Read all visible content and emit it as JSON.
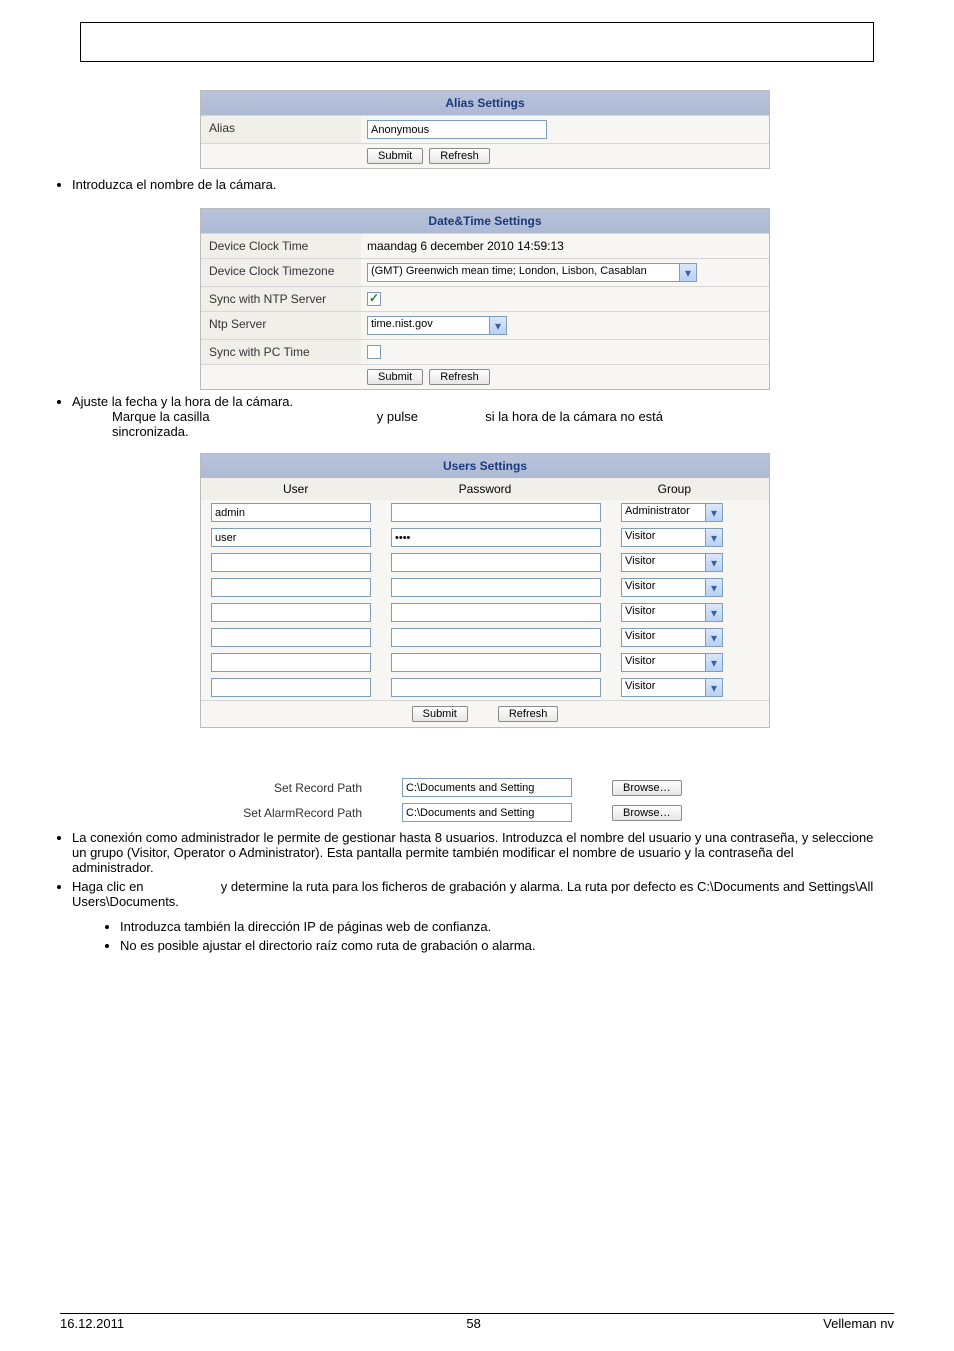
{
  "alias": {
    "title": "Alias Settings",
    "label": "Alias",
    "value": "Anonymous",
    "submit": "Submit",
    "refresh": "Refresh"
  },
  "text1": "Introduzca el nombre de la cámara.",
  "datetime": {
    "title": "Date&Time Settings",
    "r1lbl": "Device Clock Time",
    "r1val": "maandag 6 december 2010 14:59:13",
    "r2lbl": "Device Clock Timezone",
    "r2val": "(GMT) Greenwich mean time; London, Lisbon, Casablan",
    "r3lbl": "Sync with NTP Server",
    "r4lbl": "Ntp Server",
    "r4val": "time.nist.gov",
    "r5lbl": "Sync with PC Time",
    "submit": "Submit",
    "refresh": "Refresh"
  },
  "text2a": "Ajuste la fecha y la hora de la cámara.",
  "text2b": "Marque la casilla",
  "text2c": "y pulse",
  "text2d": "si la hora de la cámara no está",
  "text2e": "sincronizada.",
  "users": {
    "title": "Users Settings",
    "col_user": "User",
    "col_pass": "Password",
    "col_group": "Group",
    "rows": [
      {
        "user": "admin",
        "pass": "",
        "group": "Administrator"
      },
      {
        "user": "user",
        "pass": "••••",
        "group": "Visitor"
      },
      {
        "user": "",
        "pass": "",
        "group": "Visitor"
      },
      {
        "user": "",
        "pass": "",
        "group": "Visitor"
      },
      {
        "user": "",
        "pass": "",
        "group": "Visitor"
      },
      {
        "user": "",
        "pass": "",
        "group": "Visitor"
      },
      {
        "user": "",
        "pass": "",
        "group": "Visitor"
      },
      {
        "user": "",
        "pass": "",
        "group": "Visitor"
      }
    ],
    "submit": "Submit",
    "refresh": "Refresh"
  },
  "paths": {
    "r1lbl": "Set Record Path",
    "r1val": "C:\\Documents and Setting",
    "r2lbl": "Set AlarmRecord Path",
    "r2val": "C:\\Documents and Setting",
    "browse": "Browse…"
  },
  "para1": "La conexión como administrador le permite de gestionar hasta 8 usuarios. Introduzca el nombre del usuario y una contraseña, y seleccione un grupo (Visitor, Operator o Administrator). Esta pantalla permite también modificar el nombre de usuario y la contraseña del administrador.",
  "para2a": "Haga clic en",
  "para2b": "y determine la ruta para los ficheros de grabación y alarma. La ruta por defecto es C:\\Documents and Settings\\All Users\\Documents.",
  "sub1": "Introduzca también la dirección IP de páginas web de confianza.",
  "sub2": "No es posible ajustar el directorio raíz como ruta de grabación o alarma.",
  "footer": {
    "date": "16.12.2011",
    "page": "58",
    "company": "Velleman nv"
  }
}
